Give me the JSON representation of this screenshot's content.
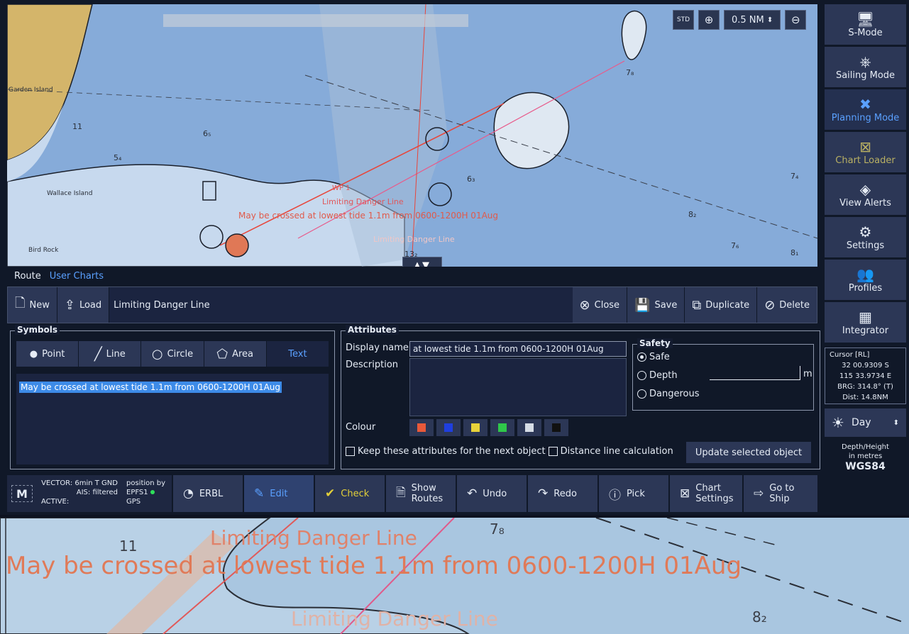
{
  "chart": {
    "scale": "0.5 NM",
    "scale_arrow": "⬍",
    "zoom_in_icon": "plus-magnifier",
    "zoom_out_icon": "minus-magnifier",
    "std_badge": "STD",
    "splitter_label": "▲▼",
    "labels": {
      "ldl_top": "Limiting Danger Line",
      "ldl_bottom": "Limiting Danger Line",
      "main_text": "May be crossed at lowest tide 1.1m from 0600-1200H 01Aug",
      "wp": "WP 1"
    },
    "soundings": [
      "11",
      "7₈",
      "8₂",
      "6₅",
      "5₄",
      "7₄",
      "6₃",
      "13₂",
      "7₆",
      "8₁"
    ],
    "place_names": [
      "Garden Island",
      "Wallace Island",
      "Bird Rock"
    ]
  },
  "sidebar": {
    "items": [
      {
        "label": "S-Mode",
        "icon": "monitor-icon"
      },
      {
        "label": "Sailing Mode",
        "icon": "ship-wheel-icon"
      },
      {
        "label": "Planning Mode",
        "icon": "planning-tools-icon"
      },
      {
        "label": "Chart Loader",
        "icon": "chart-loader-icon"
      },
      {
        "label": "View Alerts",
        "icon": "alert-diamond-icon"
      },
      {
        "label": "Settings",
        "icon": "gear-icon"
      },
      {
        "label": "Profiles",
        "icon": "users-icon"
      },
      {
        "label": "Integrator",
        "icon": "integrator-icon"
      }
    ],
    "cursor": {
      "caption": "Cursor [RL]",
      "lat": "32 00.9309 S",
      "lon": "115 33.9734 E",
      "brg": "BRG: 314.8° (T)",
      "dist": "Dist: 14.8NM"
    },
    "day": {
      "label": "Day",
      "arrow": "⬍"
    },
    "depth": {
      "line1": "Depth/Height",
      "line2": "in metres",
      "datum": "WGS84"
    }
  },
  "tabs": {
    "route": "Route",
    "user_charts": "User Charts"
  },
  "toolbar": {
    "new_label": "New",
    "load_label": "Load",
    "object_name": "Limiting Danger Line",
    "close_label": "Close",
    "save_label": "Save",
    "duplicate_label": "Duplicate",
    "delete_label": "Delete"
  },
  "symbols": {
    "title": "Symbols",
    "point": "Point",
    "line": "Line",
    "circle": "Circle",
    "area": "Area",
    "text": "Text",
    "selected_text": "May be crossed at lowest tide 1.1m from 0600-1200H 01Aug"
  },
  "attributes": {
    "title": "Attributes",
    "display_name_label": "Display name",
    "display_name_value": "at lowest tide 1.1m from 0600-1200H 01Aug",
    "description_label": "Description",
    "colour_label": "Colour",
    "colours": [
      "#e8593a",
      "#1f3fe0",
      "#e8d23a",
      "#2fc74a",
      "#d6dde6",
      "#111111"
    ],
    "keep_label": "Keep these attributes for the next object",
    "distance_label": "Distance line calculation",
    "update_label": "Update selected object",
    "safety": {
      "title": "Safety",
      "safe": "Safe",
      "depth": "Depth",
      "unit": "m",
      "dangerous": "Dangerous"
    }
  },
  "status": {
    "logo": "M",
    "vector": "VECTOR: 6min T GND",
    "ais": "AIS: filtered",
    "active": "ACTIVE:",
    "position_by": "position by",
    "epfs": "EPFS1",
    "gps": "GPS",
    "buttons": {
      "erbl": "ERBL",
      "edit": "Edit",
      "check": "Check",
      "show_routes_1": "Show",
      "show_routes_2": "Routes",
      "undo": "Undo",
      "redo": "Redo",
      "pick": "Pick",
      "chart_settings_1": "Chart",
      "chart_settings_2": "Settings",
      "go_to_ship_1": "Go to",
      "go_to_ship_2": "Ship"
    }
  },
  "zoom": {
    "ldl": "Limiting Danger Line",
    "main": "May be crossed at lowest tide 1.1m from 0600-1200H 01Aug",
    "ldl2": "Limiting Danger Line",
    "soundings": [
      "11",
      "7₈",
      "8₂"
    ]
  }
}
